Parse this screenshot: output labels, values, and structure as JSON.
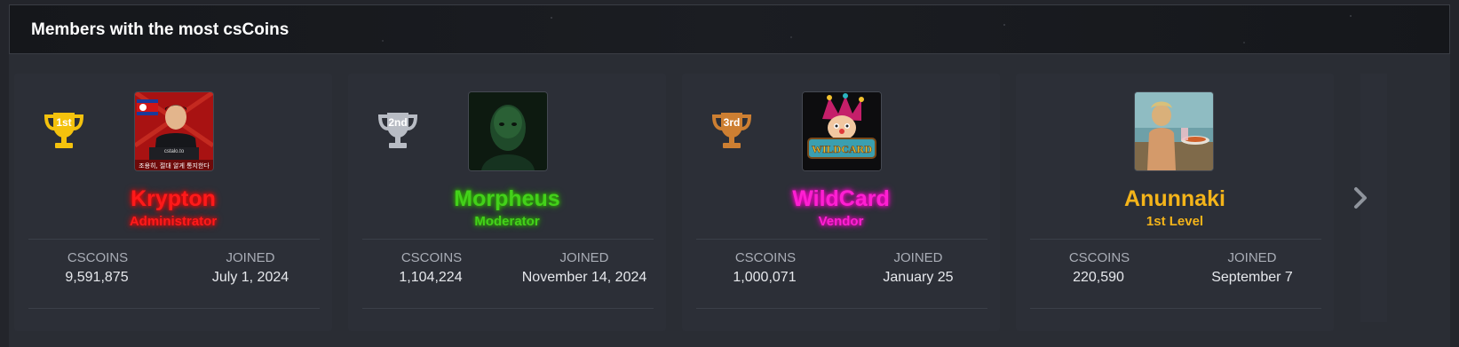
{
  "header": {
    "title": "Members with the most csCoins"
  },
  "labels": {
    "coins": "CSCOINS",
    "joined": "JOINED"
  },
  "members": [
    {
      "rank": "1st",
      "trophy_color": "#f4c20d",
      "name": "Krypton",
      "role": "Administrator",
      "coins": "9,591,875",
      "joined": "July 1, 2024",
      "avatar_text": "cstalo.to",
      "avatar_caption": "조용히, 절대 알게 통지한다"
    },
    {
      "rank": "2nd",
      "trophy_color": "#b8bcc4",
      "name": "Morpheus",
      "role": "Moderator",
      "coins": "1,104,224",
      "joined": "November 14, 2024"
    },
    {
      "rank": "3rd",
      "trophy_color": "#cd7f32",
      "name": "WildCard",
      "role": "Vendor",
      "coins": "1,000,071",
      "joined": "January 25",
      "avatar_text": "WILDCARD"
    },
    {
      "name": "Anunnaki",
      "role": "1st Level",
      "coins": "220,590",
      "joined": "September 7"
    }
  ],
  "colors": {
    "background": "#23252b",
    "card": "#2c2f37",
    "administrator": "#ff1a1a",
    "moderator": "#43d11a",
    "vendor": "#ff1fd2",
    "level": "#f4b41a"
  },
  "icons": {
    "trophy": "trophy-icon",
    "next": "chevron-right-icon"
  }
}
